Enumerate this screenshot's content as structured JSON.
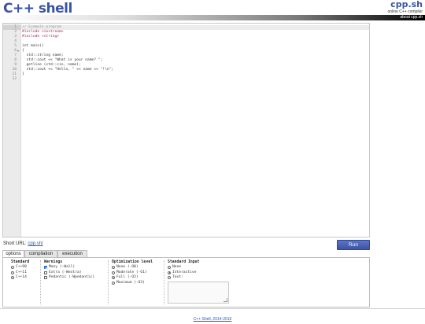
{
  "header": {
    "logo": "C++ shell",
    "brand_name": "cpp.sh",
    "brand_tagline": "online C++ compiler",
    "about_link": "about cpp.sh"
  },
  "editor": {
    "lines": [
      "1",
      "2",
      "3",
      "4",
      "5",
      "6",
      "7",
      "8",
      "9",
      "10",
      "11",
      "12"
    ],
    "code": [
      "// Example program",
      "#include <iostream>",
      "#include <string>",
      "",
      "int main()",
      "{",
      "  std::string name;",
      "  std::cout << \"What is your name? \";",
      "  getline (std::cin, name);",
      "  std::cout << \"Hello, \" << name << \"!\\n\";",
      "}",
      ""
    ]
  },
  "short_url": {
    "label": "Short URL:",
    "link": "cpp.sh/"
  },
  "run_label": "Run",
  "tabs": [
    "options",
    "compilation",
    "execution"
  ],
  "options": {
    "standard": {
      "title": "Standard",
      "items": [
        "C++98",
        "C++11",
        "C++14"
      ],
      "selected": 2
    },
    "warnings": {
      "title": "Warnings",
      "items": [
        "Many (-Wall)",
        "Extra (-Wextra)",
        "Pedantic (-Wpedantic)"
      ],
      "checked": [
        true,
        false,
        false
      ]
    },
    "optimization": {
      "title": "Optimization level",
      "items": [
        "None (-O0)",
        "Moderate (-O1)",
        "Full (-O2)",
        "Maximum (-O3)"
      ],
      "selected": 2
    },
    "stdin": {
      "title": "Standard Input",
      "items": [
        "None",
        "Interactive",
        "Text:"
      ],
      "selected": 1
    }
  },
  "footer": "C++ Shell, 2014-2015",
  "colors": {
    "accent": "#3a53a4",
    "link": "#2255cc",
    "check": "#2f6fd8"
  }
}
